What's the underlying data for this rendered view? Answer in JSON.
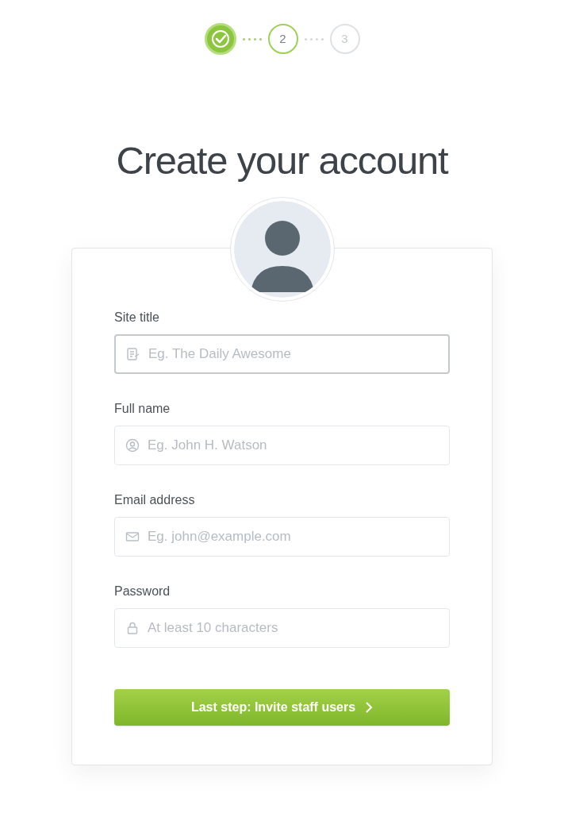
{
  "steps": [
    {
      "completed": true,
      "selected": false
    },
    {
      "label": "2",
      "completed": false,
      "selected": true
    },
    {
      "label": "3",
      "completed": false,
      "selected": false
    }
  ],
  "title": "Create your account",
  "fields": [
    {
      "label": "Site title",
      "placeholder": "Eg. The Daily Awesome",
      "kind": "document",
      "focused": true
    },
    {
      "label": "Full name",
      "placeholder": "Eg. John H. Watson",
      "kind": "person",
      "focused": false
    },
    {
      "label": "Email address",
      "placeholder": "Eg. john@example.com",
      "kind": "mail",
      "focused": false
    },
    {
      "label": "Password",
      "placeholder": "At least 10 characters",
      "kind": "lock",
      "focused": false
    }
  ],
  "submit": {
    "label": "Last step: Invite staff users"
  }
}
